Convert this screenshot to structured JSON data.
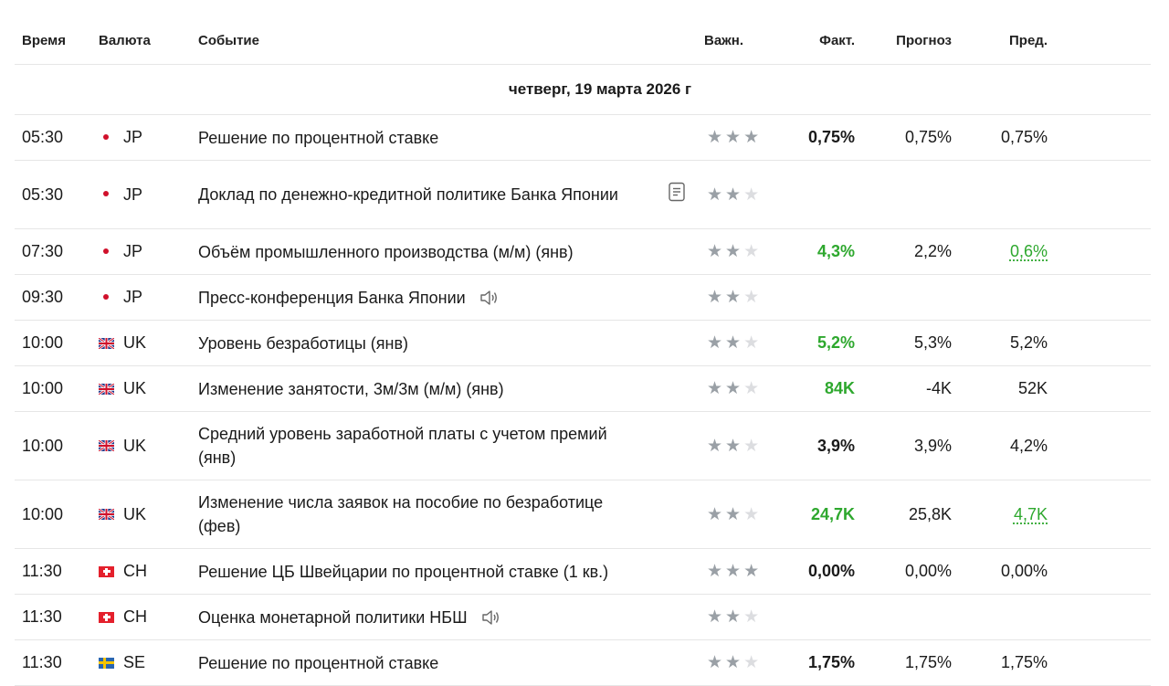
{
  "headers": {
    "time": "Время",
    "currency": "Валюта",
    "event": "Событие",
    "importance": "Важн.",
    "actual": "Факт.",
    "forecast": "Прогноз",
    "previous": "Пред."
  },
  "date_label": "четверг, 19 марта 2026 г",
  "colors": {
    "positive": "#2ea82e",
    "star_active": "#9aa0a6",
    "star_inactive": "#dcdde0"
  },
  "rows": [
    {
      "time": "05:30",
      "currency": "JP",
      "flag_icon": "japan-flag-icon",
      "event": "Решение по процентной ставке",
      "importance": 3,
      "actual": "0,75%",
      "forecast": "0,75%",
      "previous": "0,75%"
    },
    {
      "time": "05:30",
      "currency": "JP",
      "flag_icon": "japan-flag-icon",
      "event": "Доклад по денежно-кредитной политике Банка Японии",
      "importance": 2,
      "icon": "document-icon"
    },
    {
      "time": "07:30",
      "currency": "JP",
      "flag_icon": "japan-flag-icon",
      "event": "Объём промышленного производства (м/м) (янв)",
      "importance": 2,
      "actual": "4,3%",
      "forecast": "2,2%",
      "previous": "0,6%"
    },
    {
      "time": "09:30",
      "currency": "JP",
      "flag_icon": "japan-flag-icon",
      "event": "Пресс-конференция Банка Японии",
      "importance": 2,
      "icon": "speaker-icon"
    },
    {
      "time": "10:00",
      "currency": "UK",
      "flag_icon": "uk-flag-icon",
      "event": "Уровень безработицы (янв)",
      "importance": 2,
      "actual": "5,2%",
      "forecast": "5,3%",
      "previous": "5,2%"
    },
    {
      "time": "10:00",
      "currency": "UK",
      "flag_icon": "uk-flag-icon",
      "event": "Изменение занятости, 3м/3м (м/м) (янв)",
      "importance": 2,
      "actual": "84K",
      "forecast": "-4K",
      "previous": "52K"
    },
    {
      "time": "10:00",
      "currency": "UK",
      "flag_icon": "uk-flag-icon",
      "event": "Средний уровень заработной платы с учетом премий (янв)",
      "importance": 2,
      "actual": "3,9%",
      "forecast": "3,9%",
      "previous": "4,2%"
    },
    {
      "time": "10:00",
      "currency": "UK",
      "flag_icon": "uk-flag-icon",
      "event": "Изменение числа заявок на пособие по безработице (фев)",
      "importance": 2,
      "actual": "24,7K",
      "forecast": "25,8K",
      "previous": "4,7K"
    },
    {
      "time": "11:30",
      "currency": "CH",
      "flag_icon": "switzerland-flag-icon",
      "event": "Решение ЦБ Швейцарии по процентной ставке (1 кв.)",
      "importance": 3,
      "actual": "0,00%",
      "forecast": "0,00%",
      "previous": "0,00%"
    },
    {
      "time": "11:30",
      "currency": "CH",
      "flag_icon": "switzerland-flag-icon",
      "event": "Оценка монетарной политики НБШ",
      "importance": 2,
      "icon": "speaker-icon"
    },
    {
      "time": "11:30",
      "currency": "SE",
      "flag_icon": "sweden-flag-icon",
      "event": "Решение по процентной ставке",
      "importance": 2,
      "actual": "1,75%",
      "forecast": "1,75%",
      "previous": "1,75%"
    }
  ]
}
